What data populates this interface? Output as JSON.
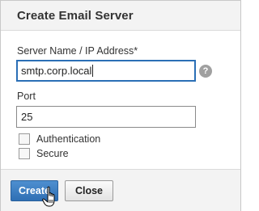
{
  "dialog": {
    "title": "Create Email Server"
  },
  "form": {
    "server_label": "Server Name / IP Address*",
    "server_value": "smtp.corp.local",
    "help_icon": "help-question-icon",
    "help_glyph": "?",
    "port_label": "Port",
    "port_value": "25",
    "authentication": {
      "label": "Authentication",
      "checked": false
    },
    "secure": {
      "label": "Secure",
      "checked": false
    }
  },
  "footer": {
    "create_label": "Create",
    "close_label": "Close"
  },
  "colors": {
    "primary": "#2f6fb4",
    "focus_border": "#2b6fb6"
  },
  "cursor": "hand-pointer-icon"
}
